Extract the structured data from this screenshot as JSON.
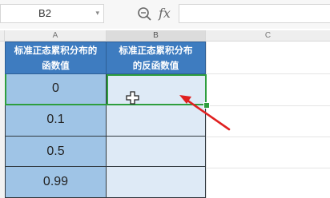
{
  "formula_bar": {
    "name_box": "B2",
    "formula_value": "",
    "zoom_icon": "zoom-icon",
    "fx_label": "fx"
  },
  "columns": [
    {
      "label": "A"
    },
    {
      "label": "B"
    },
    {
      "label": "C"
    }
  ],
  "table": {
    "header_a": [
      "标准正态累积分布的",
      "函数值"
    ],
    "header_b": [
      "标准正态累积分布",
      "的反函数值"
    ],
    "values_a": [
      "0",
      "0.1",
      "0.5",
      "0.99"
    ]
  },
  "selected_cell": "B2",
  "colors": {
    "header_fill": "#3e7cc0",
    "col_a_fill": "#9fc4e6",
    "col_b_fill": "#deeaf6",
    "selection": "#2e9e3e",
    "annotation_arrow": "#e02020"
  },
  "icons": [
    "zoom-icon",
    "dropdown-caret-icon",
    "cell-cursor-icon",
    "annotation-arrow"
  ]
}
